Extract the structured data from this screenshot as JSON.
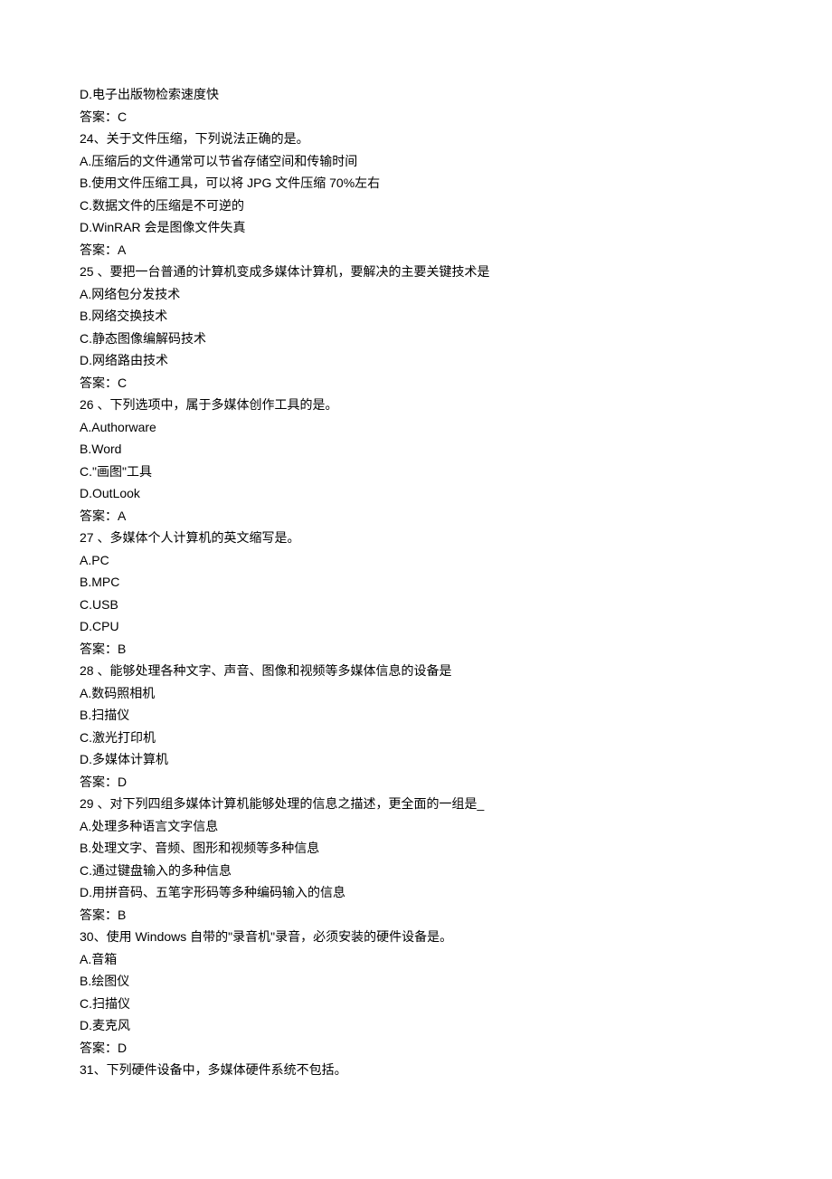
{
  "lines": [
    "D.电子出版物检索速度快",
    "答案：C",
    "24、关于文件压缩，下列说法正确的是。",
    "A.压缩后的文件通常可以节省存储空间和传输时间",
    "B.使用文件压缩工具，可以将 JPG 文件压缩 70%左右",
    "C.数据文件的压缩是不可逆的",
    "D.WinRAR 会是图像文件失真",
    "答案：A",
    "25  、要把一台普通的计算机变成多媒体计算机，要解决的主要关键技术是",
    "A.网络包分发技术",
    "B.网络交换技术",
    "C.静态图像编解码技术",
    "D.网络路由技术",
    "答案：C",
    "26  、下列选项中，属于多媒体创作工具的是。",
    "A.Authorware",
    "B.Word",
    "C.\"画图\"工具",
    "D.OutLook",
    "答案：A",
    "27  、多媒体个人计算机的英文缩写是。",
    "A.PC",
    "B.MPC",
    "C.USB",
    "D.CPU",
    "答案：B",
    "28  、能够处理各种文字、声音、图像和视频等多媒体信息的设备是",
    "A.数码照相机",
    "B.扫描仪",
    "C.激光打印机",
    "D.多媒体计算机",
    "答案：D",
    "29  、对下列四组多媒体计算机能够处理的信息之描述，更全面的一组是_",
    "A.处理多种语言文字信息",
    "B.处理文字、音频、图形和视频等多种信息",
    "C.通过键盘输入的多种信息",
    "D.用拼音码、五笔字形码等多种编码输入的信息",
    "答案：B",
    "30、使用 Windows 自带的\"录音机\"录音，必须安装的硬件设备是。",
    "A.音箱",
    "B.绘图仪",
    "C.扫描仪",
    "D.麦克风",
    "答案：D",
    "31、下列硬件设备中，多媒体硬件系统不包括。"
  ]
}
